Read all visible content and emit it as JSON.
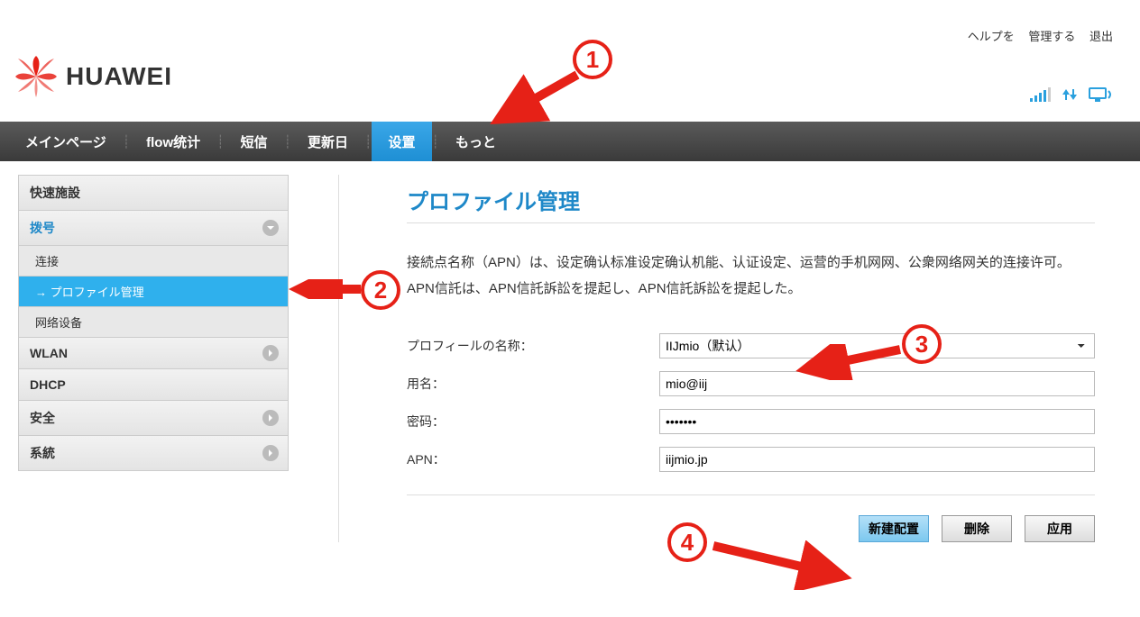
{
  "topLinks": {
    "help": "ヘルプを",
    "manage": "管理する",
    "logout": "退出"
  },
  "brand": "HUAWEI",
  "nav": {
    "items": [
      {
        "label": "メインページ"
      },
      {
        "label": "flow统计"
      },
      {
        "label": "短信"
      },
      {
        "label": "更新日"
      },
      {
        "label": "设置",
        "active": true
      },
      {
        "label": "もっと"
      }
    ]
  },
  "sidebar": {
    "items": [
      {
        "label": "快速施設"
      },
      {
        "label": "拨号",
        "open": true,
        "children": [
          {
            "label": "连接"
          },
          {
            "label": "プロファイル管理",
            "active": true
          },
          {
            "label": "网络设备"
          }
        ]
      },
      {
        "label": "WLAN"
      },
      {
        "label": "DHCP"
      },
      {
        "label": "安全"
      },
      {
        "label": "系統"
      }
    ]
  },
  "page": {
    "title": "プロファイル管理",
    "description": "接続点名称（APN）は、设定确认标准设定确认机能、认证设定、运营的手机网网、公衆网络网关的连接许可。 APN信託は、APN信託訴訟を提起し、APN信託訴訟を提起した。"
  },
  "form": {
    "profileNameLabel": "プロフィールの名称：",
    "profileNameValue": "IIJmio（默认）",
    "usernameLabel": "用名：",
    "usernameValue": "mio@iij",
    "passwordLabel": "密码：",
    "passwordValue": "•••••••",
    "apnLabel": "APN：",
    "apnValue": "iijmio.jp"
  },
  "buttons": {
    "new": "新建配置",
    "delete": "删除",
    "apply": "应用"
  },
  "annotations": {
    "n1": "1",
    "n2": "2",
    "n3": "3",
    "n4": "4"
  }
}
